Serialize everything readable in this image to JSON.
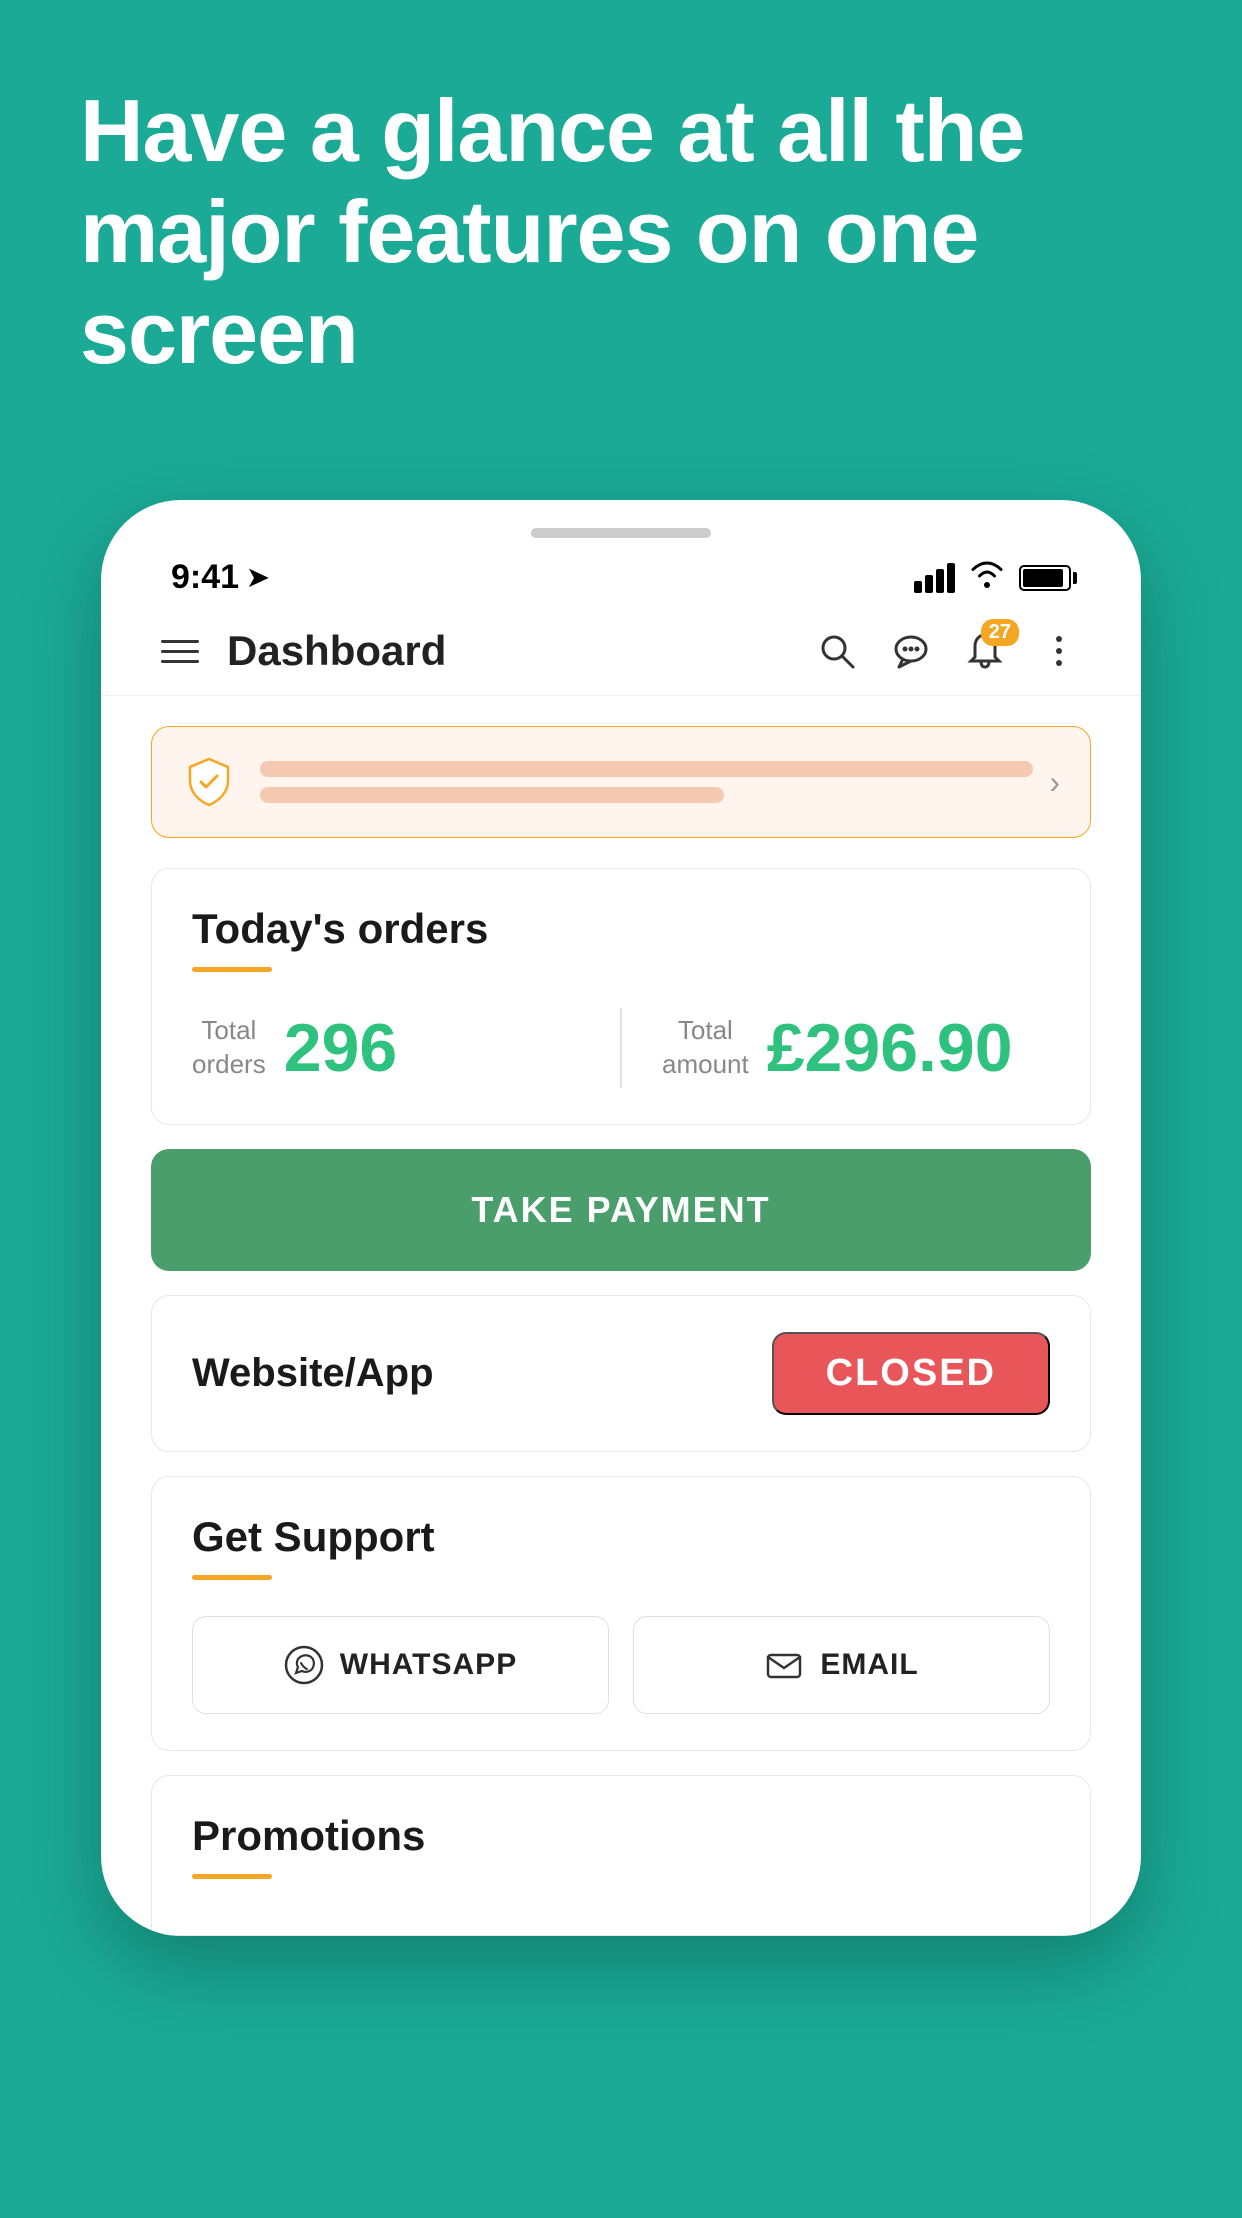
{
  "hero": {
    "text": "Have a glance at all the major features on one screen"
  },
  "status_bar": {
    "time": "9:41",
    "notification_count": "27"
  },
  "nav": {
    "title": "Dashboard",
    "search_label": "search",
    "chat_label": "chat",
    "notifications_label": "notifications",
    "more_label": "more"
  },
  "alert": {
    "chevron": "›"
  },
  "todays_orders": {
    "title": "Today's orders",
    "total_orders_label": "Total\norders",
    "total_orders_value": "296",
    "total_amount_label": "Total\namount",
    "total_amount_value": "£296.90"
  },
  "take_payment": {
    "label": "TAKE PAYMENT"
  },
  "website_app": {
    "label": "Website/App",
    "status": "CLOSED"
  },
  "get_support": {
    "title": "Get Support",
    "whatsapp_label": "WHATSAPP",
    "email_label": "EMAIL"
  },
  "promotions": {
    "title": "Promotions"
  }
}
